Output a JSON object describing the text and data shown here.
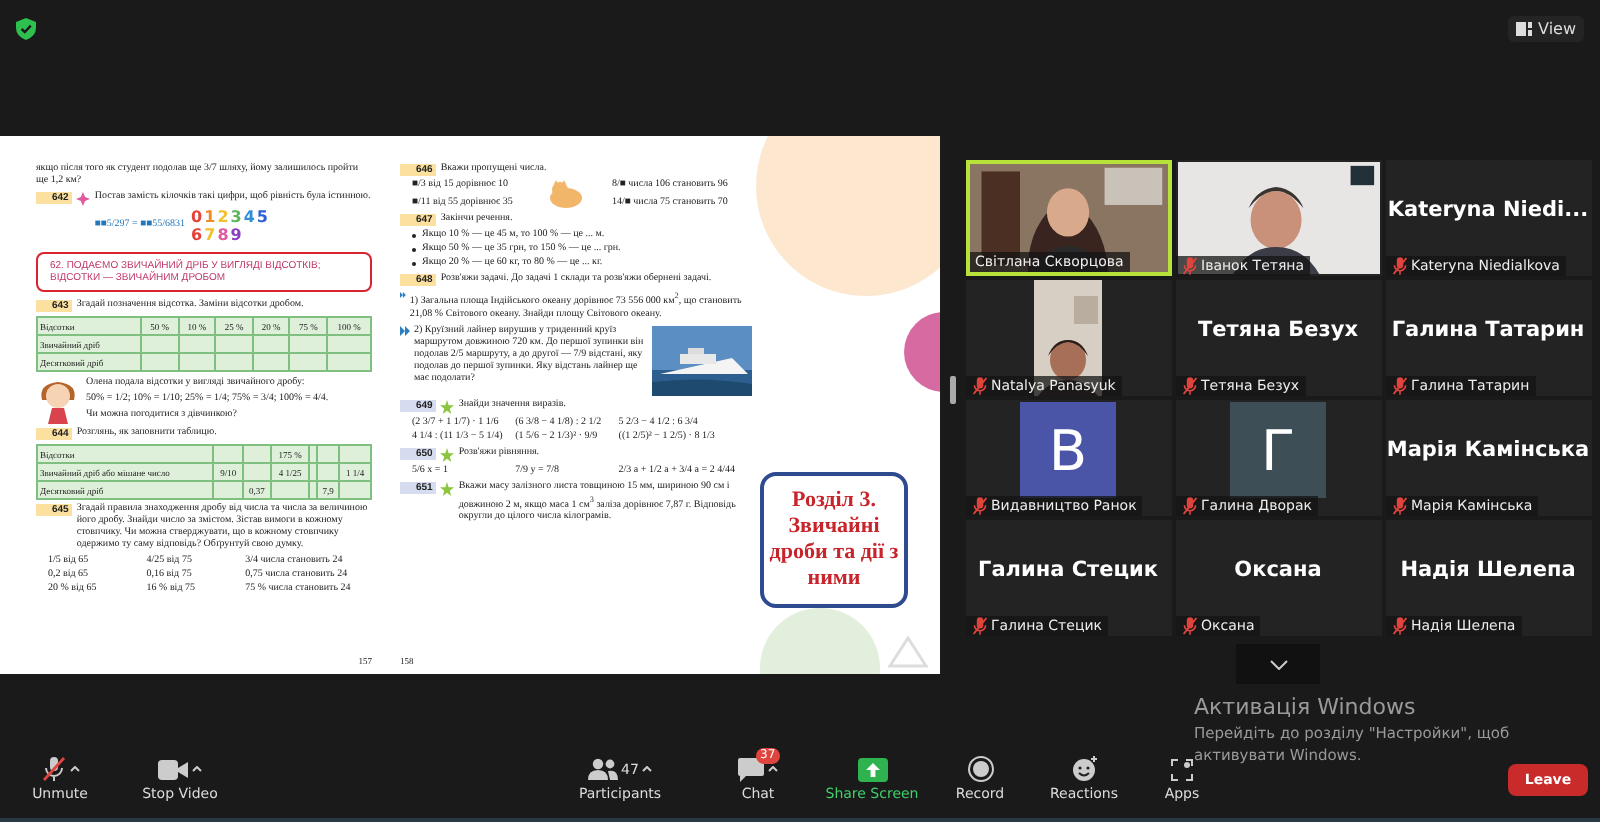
{
  "top_bar": {
    "view_label": "View"
  },
  "shared_screen": {
    "left_page": {
      "page_number": "157",
      "blocks": [
        {
          "kind": "para",
          "text": "якщо після того як студент подолав ще 3/7 шляху, йому залишилось пройти ще 1,2 км?"
        },
        {
          "kind": "exercise",
          "number": "642",
          "color": "#fbe0a0",
          "flower_mark": true,
          "text": "Постав замість кілочків такі цифри, щоб рівність була істинною.",
          "formula": "■■5/297 = ■■55/6831",
          "digits": [
            {
              "text": "0",
              "color": "#e5403a"
            },
            {
              "text": "1",
              "color": "#f08a24"
            },
            {
              "text": "2",
              "color": "#f2c12e"
            },
            {
              "text": "3",
              "color": "#5cb85c"
            },
            {
              "text": "4",
              "color": "#2f8fd8"
            },
            {
              "text": "5",
              "color": "#2f5fd8"
            },
            {
              "text": "6",
              "color": "#e5403a"
            },
            {
              "text": "7",
              "color": "#f2c12e"
            },
            {
              "text": "8",
              "color": "#e05aa0"
            },
            {
              "text": "9",
              "color": "#8a3fc0"
            }
          ]
        },
        {
          "kind": "heading",
          "text": "62. ПОДАЄМО ЗВИЧАЙНИЙ ДРІБ У ВИГЛЯДІ ВІДСОТКІВ; ВІДСОТКИ — ЗВИЧАЙНИМ ДРОБОМ"
        },
        {
          "kind": "exercise",
          "number": "643",
          "color": "#fbe0a0",
          "text": "Згадай позначення відсотка. Заміни відсотки дробом."
        },
        {
          "kind": "table",
          "rows": [
            [
              "Відсотки",
              "50 %",
              "10 %",
              "25 %",
              "20 %",
              "75 %",
              "100 %"
            ],
            [
              "Звичайний дріб",
              null,
              null,
              null,
              null,
              null,
              null
            ],
            [
              "Десятковий дріб",
              null,
              null,
              null,
              null,
              null,
              null
            ]
          ]
        },
        {
          "kind": "girl",
          "lines": [
            "Олена подала відсотки у вигляді звичайного дробу:",
            "50% = 1/2; 10% = 1/10; 25% = 1/4; 75% = 3/4; 100% = 4/4.",
            "Чи можна погодитися з дівчинкою?"
          ]
        },
        {
          "kind": "exercise",
          "number": "644",
          "color": "#fbe0a0",
          "text": "Розглянь, як заповнити таблицю."
        },
        {
          "kind": "table",
          "rows": [
            [
              "Відсотки",
              null,
              null,
              "175 %",
              null,
              null,
              null
            ],
            [
              "Звичайний дріб або мішане число",
              "9/10",
              null,
              "4 1/25",
              null,
              null,
              "1 1/4"
            ],
            [
              "Десятковий дріб",
              null,
              "0,37",
              null,
              null,
              "7,9",
              null
            ]
          ]
        },
        {
          "kind": "exercise",
          "number": "645",
          "color": "#fbe0a0",
          "text": "Згадай правила знаходження дробу від числа та числа за величиною його дробу. Знайди число за змістом. Зістав вимоги в кожному стовпчику. Чи можна стверджувати, що в кожному стовпчику одержимо ту саму відповідь? Обґрунтуй свою думку."
        },
        {
          "kind": "grid",
          "rows": [
            [
              "1/5 від 65",
              "4/25 від 75",
              "3/4 числа становить 24"
            ],
            [
              "0,2 від 65",
              "0,16 від 75",
              "0,75 числа становить 24"
            ],
            [
              "20 % від 65",
              "16 % від 75",
              "75 % числа становить 24"
            ]
          ]
        }
      ]
    },
    "right_page": {
      "page_number": "158",
      "blocks": [
        {
          "kind": "exercise",
          "number": "646",
          "color": "#fbe0a0",
          "text": "Вкажи пропущені числа."
        },
        {
          "kind": "cat_grid",
          "rows": [
            [
              "■/3 від 15 дорівнює 10",
              "8/■ числа 106 становить 96"
            ],
            [
              "■/11 від 55 дорівнює 35",
              "14/■ числа 75 становить 70"
            ]
          ]
        },
        {
          "kind": "exercise",
          "number": "647",
          "color": "#fbe0a0",
          "text": "Закінчи речення."
        },
        {
          "kind": "bullets",
          "items": [
            "Якщо 10 % — це 45 м, то 100 % — це ... м.",
            "Якщо 50 % — це 35 грн, то 150 % — це ... грн.",
            "Якщо 20 % — це 60 кг, то 80 % — це ... кг."
          ]
        },
        {
          "kind": "exercise",
          "number": "648",
          "color": "#fbe0a0",
          "text": "Розв'яжи задачі. До задачі 1 склади та розв'яжи обернені задачі."
        },
        {
          "kind": "task",
          "text": "1) Загальна площа Індійського океану дорівнює 73 556 000 км$^{2}$, що становить 21,08 % Світового океану. Знайди площу Світового океану."
        },
        {
          "kind": "task_picture",
          "text": "2) Круїзний лайнер вирушив у триденний круїз маршрутом довжиною 720 км. До першої зупинки він подолав 2/5 маршруту, а до другої — 7/9 відстані, яку подолав до першої зупинки. Яку відстань лайнер ще має подолати?"
        },
        {
          "kind": "exercise",
          "number": "649",
          "color": "#d6dcef",
          "star_mark": true,
          "text": "Знайди значення виразів."
        },
        {
          "kind": "grid",
          "rows": [
            [
              "(2 3/7 + 1 1/7) · 1 1/6",
              "(6 3/8 − 4 1/8) : 2 1/2",
              "5 2/3 − 4 1/2 : 6 3/4"
            ],
            [
              "4 1/4 : (11 1/3 − 5 1/4)",
              "(1 5/6 − 2 1/3)² · 9/9",
              "((1 2/5)² − 1 2/5) · 8 1/3"
            ]
          ]
        },
        {
          "kind": "exercise",
          "number": "650",
          "color": "#d6dcef",
          "star_mark": true,
          "text": "Розв'яжи рівняння."
        },
        {
          "kind": "grid",
          "rows": [
            [
              "5/6 x = 1",
              "7/9 y = 7/8",
              "2/3 a + 1/2 a + 3/4 a = 2 4/44"
            ]
          ]
        },
        {
          "kind": "exercise",
          "number": "651",
          "color": "#d6dcef",
          "star_mark": true,
          "text": "Вкажи масу залізного листа товщиною 15 мм, шириною 90 см і довжиною 2 м, якщо маса 1 см$^{3}$ заліза дорівнює 7,87 г. Відповідь округли до цілого числа кілограмів."
        }
      ]
    },
    "chapter_box": "Розділ 3. Звичайні дроби та дії з ними"
  },
  "gallery": [
    {
      "kind": "video",
      "name": "Світлана Скворцова",
      "speaking": true,
      "muted": false
    },
    {
      "kind": "video",
      "name": "Іванок Тетяна",
      "speaking": false,
      "muted": true
    },
    {
      "kind": "name",
      "title": "Kateryna  Niedi...",
      "name": "Kateryna Niedialkova",
      "speaking": false,
      "muted": true
    },
    {
      "kind": "small_video",
      "name": "Natalya Panasyuk",
      "speaking": false,
      "muted": true
    },
    {
      "kind": "name",
      "title": "Тетяна Безух",
      "name": "Тетяна Безух",
      "speaking": false,
      "muted": true
    },
    {
      "kind": "name",
      "title": "Галина Татарин",
      "name": "Галина Татарин",
      "speaking": false,
      "muted": true
    },
    {
      "kind": "avatar",
      "letter": "В",
      "color": "#4a55a8",
      "name": "Видавництво Ранок",
      "speaking": false,
      "muted": true
    },
    {
      "kind": "avatar",
      "letter": "Г",
      "color": "#3e4e57",
      "name": "Галина Дворак",
      "speaking": false,
      "muted": true
    },
    {
      "kind": "name",
      "title": "Марія Камінська",
      "name": "Марія Камінська",
      "speaking": false,
      "muted": true
    },
    {
      "kind": "name",
      "title": "Галина Стецик",
      "name": "Галина Стецик",
      "speaking": false,
      "muted": true
    },
    {
      "kind": "name",
      "title": "Оксана",
      "name": "Оксана",
      "speaking": false,
      "muted": true
    },
    {
      "kind": "name",
      "title": "Надія Шелепа",
      "name": "Надія Шелепа",
      "speaking": false,
      "muted": true
    }
  ],
  "windows_notice": {
    "title": "Активація Windows",
    "text": "Перейдіть до розділу \"Настройки\", щоб активувати Windows."
  },
  "toolbar": [
    {
      "kind": "mic",
      "label": "Unmute",
      "muted": true
    },
    {
      "kind": "video",
      "label": "Stop Video"
    },
    {
      "kind": "participants",
      "label": "Participants",
      "count": "47"
    },
    {
      "kind": "chat",
      "label": "Chat",
      "badge": "37"
    },
    {
      "kind": "share",
      "label": "Share Screen"
    },
    {
      "kind": "record",
      "label": "Record"
    },
    {
      "kind": "reactions",
      "label": "Reactions"
    },
    {
      "kind": "apps",
      "label": "Apps"
    }
  ],
  "leave_button": "Leave"
}
